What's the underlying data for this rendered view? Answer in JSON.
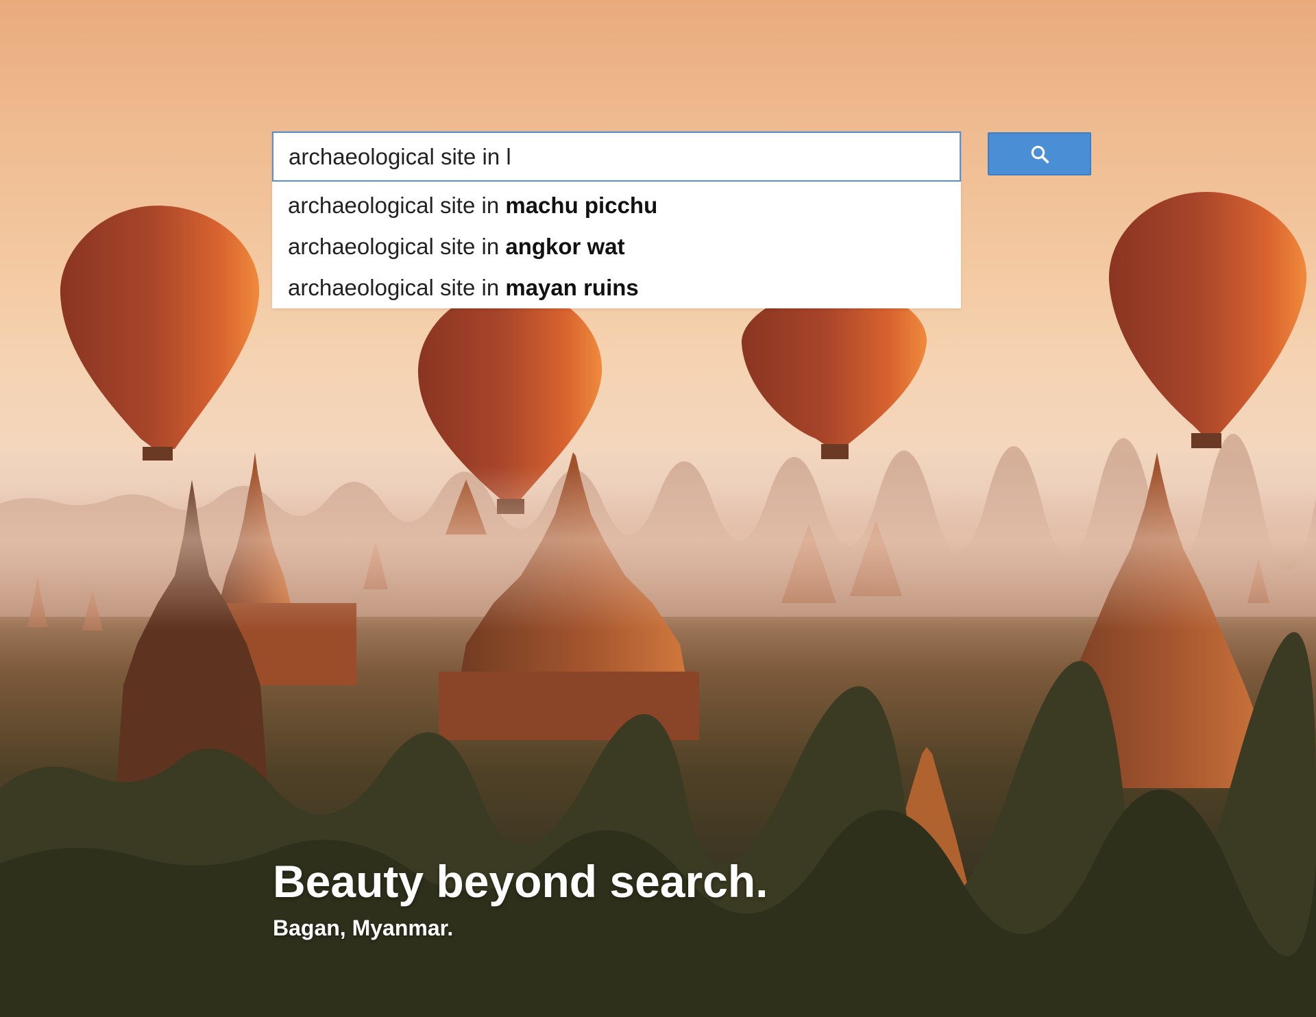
{
  "search": {
    "value": "archaeological site in l",
    "button_icon": "search-icon",
    "accent_color": "#4a8fd6"
  },
  "suggestions": [
    {
      "prefix": "archaeological site in ",
      "completion": "machu picchu"
    },
    {
      "prefix": "archaeological site in ",
      "completion": "angkor wat"
    },
    {
      "prefix": "archaeological site in ",
      "completion": "mayan ruins"
    }
  ],
  "hero": {
    "tagline": "Beauty beyond search.",
    "location": "Bagan, Myanmar."
  }
}
